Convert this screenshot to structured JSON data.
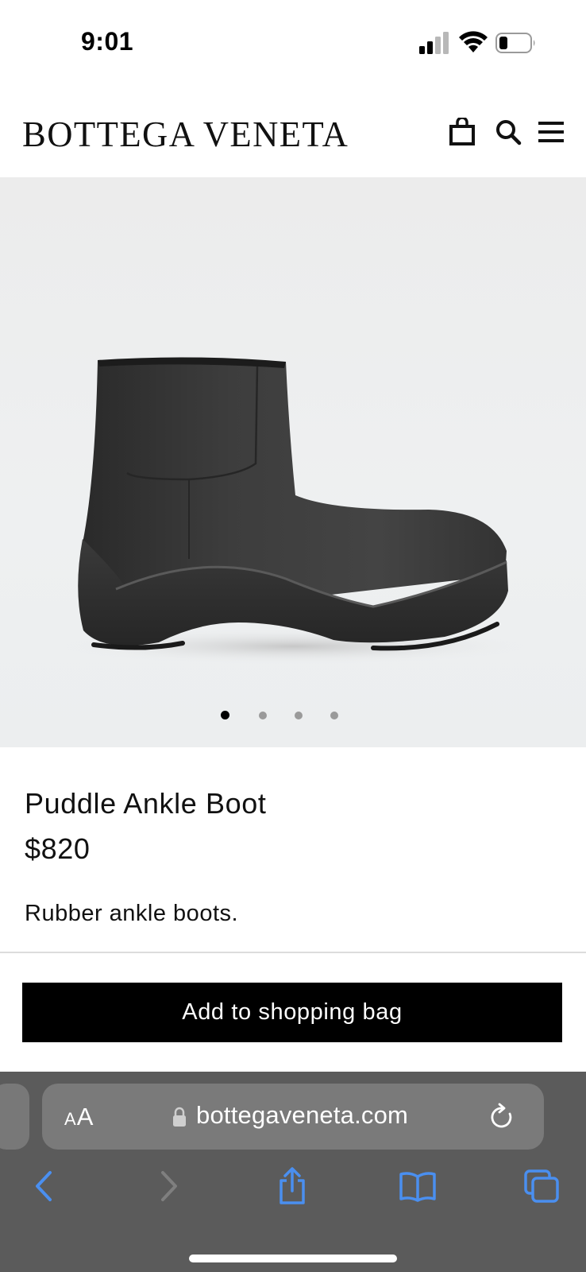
{
  "status_bar": {
    "time": "9:01"
  },
  "header": {
    "brand": "BOTTEGA VENETA",
    "icons": [
      "shopping-bag-icon",
      "search-icon",
      "menu-icon"
    ]
  },
  "gallery": {
    "slide_count": 4,
    "active_slide": 1
  },
  "product": {
    "name": "Puddle Ankle Boot",
    "price": "$820",
    "description": "Rubber ankle boots."
  },
  "actions": {
    "add_to_bag_label": "Add to shopping bag"
  },
  "browser": {
    "aa_small": "A",
    "aa_big": "A",
    "url": "bottegaveneta.com",
    "toolbar_icons": [
      "back-icon",
      "forward-icon",
      "share-icon",
      "bookmarks-icon",
      "tabs-icon"
    ]
  },
  "colors": {
    "accent_blue": "#3b82f6",
    "button_black": "#000000",
    "browser_gray": "#5b5b5b"
  }
}
